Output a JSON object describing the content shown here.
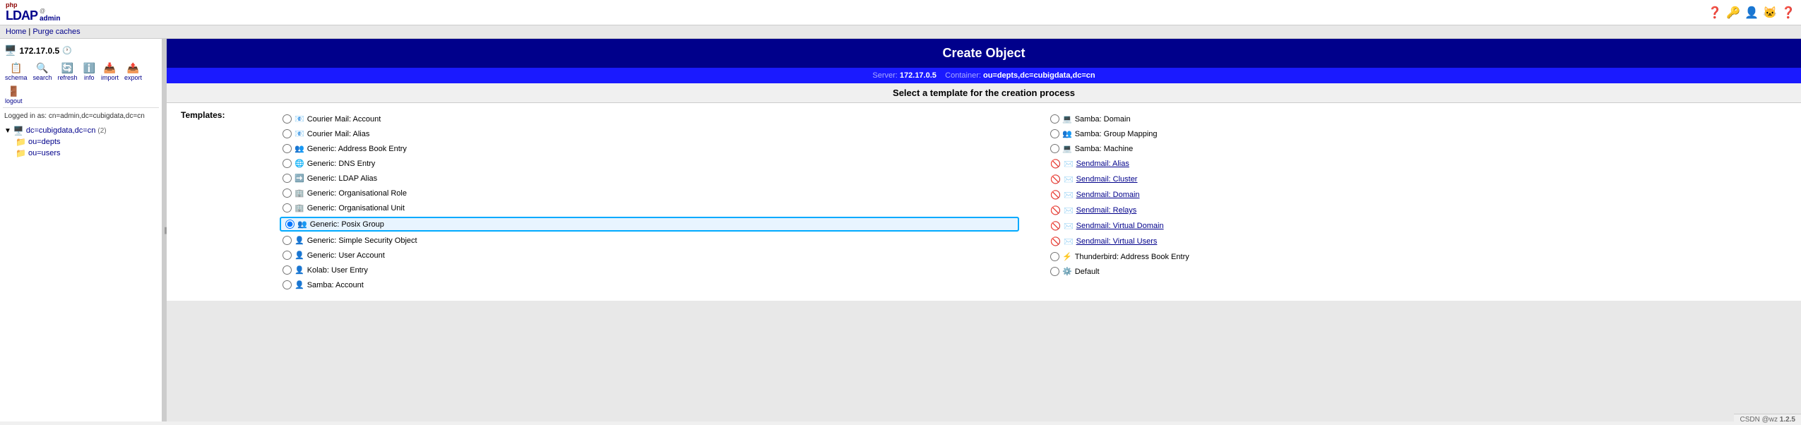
{
  "app": {
    "name": "phpLDAPadmin",
    "php_label": "php",
    "ldap_label": "LDAP",
    "admin_label": "admin"
  },
  "top_icons": [
    "?",
    "🔑",
    "👤",
    "😺",
    "?"
  ],
  "breadcrumb": {
    "home_label": "Home",
    "separator": " | ",
    "purge_label": "Purge caches"
  },
  "sidebar": {
    "server_ip": "172.17.0.5",
    "toolbar_items": [
      {
        "id": "schema",
        "label": "schema",
        "icon": "📋"
      },
      {
        "id": "search",
        "label": "search",
        "icon": "🔍"
      },
      {
        "id": "refresh",
        "label": "refresh",
        "icon": "🔄"
      },
      {
        "id": "info",
        "label": "info",
        "icon": "ℹ️"
      },
      {
        "id": "import",
        "label": "import",
        "icon": "📥"
      },
      {
        "id": "export",
        "label": "export",
        "icon": "📤"
      },
      {
        "id": "logout",
        "label": "logout",
        "icon": "🚪"
      }
    ],
    "login_info": "Logged in as: cn=admin,dc=cubigdata,dc=cn",
    "tree": {
      "root_label": "dc=cubigdata,dc=cn",
      "root_count": "(2)",
      "children": [
        {
          "label": "ou=depts",
          "icon": "📁"
        },
        {
          "label": "ou=users",
          "icon": "📁"
        }
      ]
    }
  },
  "create_object": {
    "title": "Create Object",
    "server_label": "Server:",
    "server_value": "172.17.0.5",
    "container_label": "Container:",
    "container_value": "ou=depts,dc=cubigdata,dc=cn",
    "select_template_text": "Select a template for the creation process",
    "templates_header": "Templates:"
  },
  "templates_left": [
    {
      "id": "courier_account",
      "label": "Courier Mail: Account",
      "icon": "✉️",
      "disabled": false,
      "selected": false
    },
    {
      "id": "courier_alias",
      "label": "Courier Mail: Alias",
      "icon": "✉️",
      "disabled": false,
      "selected": false
    },
    {
      "id": "generic_address_book",
      "label": "Generic: Address Book Entry",
      "icon": "👥",
      "disabled": false,
      "selected": false
    },
    {
      "id": "generic_dns",
      "label": "Generic: DNS Entry",
      "icon": "🌐",
      "disabled": false,
      "selected": false
    },
    {
      "id": "generic_ldap_alias",
      "label": "Generic: LDAP Alias",
      "icon": "📎",
      "disabled": false,
      "selected": false
    },
    {
      "id": "generic_org_role",
      "label": "Generic: Organisational Role",
      "icon": "🏢",
      "disabled": false,
      "selected": false
    },
    {
      "id": "generic_org_unit",
      "label": "Generic: Organisational Unit",
      "icon": "🏢",
      "disabled": false,
      "selected": false
    },
    {
      "id": "generic_posix_group",
      "label": "Generic: Posix Group",
      "icon": "👥",
      "disabled": false,
      "selected": true
    },
    {
      "id": "generic_simple_security",
      "label": "Generic: Simple Security Object",
      "icon": "👤",
      "disabled": false,
      "selected": false
    },
    {
      "id": "generic_user_account",
      "label": "Generic: User Account",
      "icon": "👤",
      "disabled": false,
      "selected": false
    },
    {
      "id": "kolab_user",
      "label": "Kolab: User Entry",
      "icon": "👤",
      "disabled": false,
      "selected": false
    },
    {
      "id": "samba_account",
      "label": "Samba: Account",
      "icon": "👤",
      "disabled": false,
      "selected": false
    }
  ],
  "templates_right": [
    {
      "id": "samba_domain",
      "label": "Samba: Domain",
      "icon": "💻",
      "disabled": false,
      "selected": false
    },
    {
      "id": "samba_group_mapping",
      "label": "Samba: Group Mapping",
      "icon": "👥",
      "disabled": false,
      "selected": false
    },
    {
      "id": "samba_machine",
      "label": "Samba: Machine",
      "icon": "💻",
      "disabled": false,
      "selected": false
    },
    {
      "id": "sendmail_alias",
      "label": "Sendmail: Alias",
      "icon": "✉️",
      "disabled": true,
      "selected": false
    },
    {
      "id": "sendmail_cluster",
      "label": "Sendmail: Cluster",
      "icon": "✉️",
      "disabled": true,
      "selected": false
    },
    {
      "id": "sendmail_domain",
      "label": "Sendmail: Domain",
      "icon": "✉️",
      "disabled": true,
      "selected": false
    },
    {
      "id": "sendmail_relays",
      "label": "Sendmail: Relays",
      "icon": "✉️",
      "disabled": true,
      "selected": false
    },
    {
      "id": "sendmail_virtual_domain",
      "label": "Sendmail: Virtual Domain",
      "icon": "✉️",
      "disabled": true,
      "selected": false
    },
    {
      "id": "sendmail_virtual_users",
      "label": "Sendmail: Virtual Users",
      "icon": "✉️",
      "disabled": true,
      "selected": false
    },
    {
      "id": "thunderbird_address",
      "label": "Thunderbird: Address Book Entry",
      "icon": "⚡",
      "disabled": false,
      "selected": false
    },
    {
      "id": "default",
      "label": "Default",
      "icon": "⚙️",
      "disabled": false,
      "selected": false
    }
  ],
  "status_bar": {
    "text": "CSDN @wz",
    "version": "1.2.5"
  }
}
